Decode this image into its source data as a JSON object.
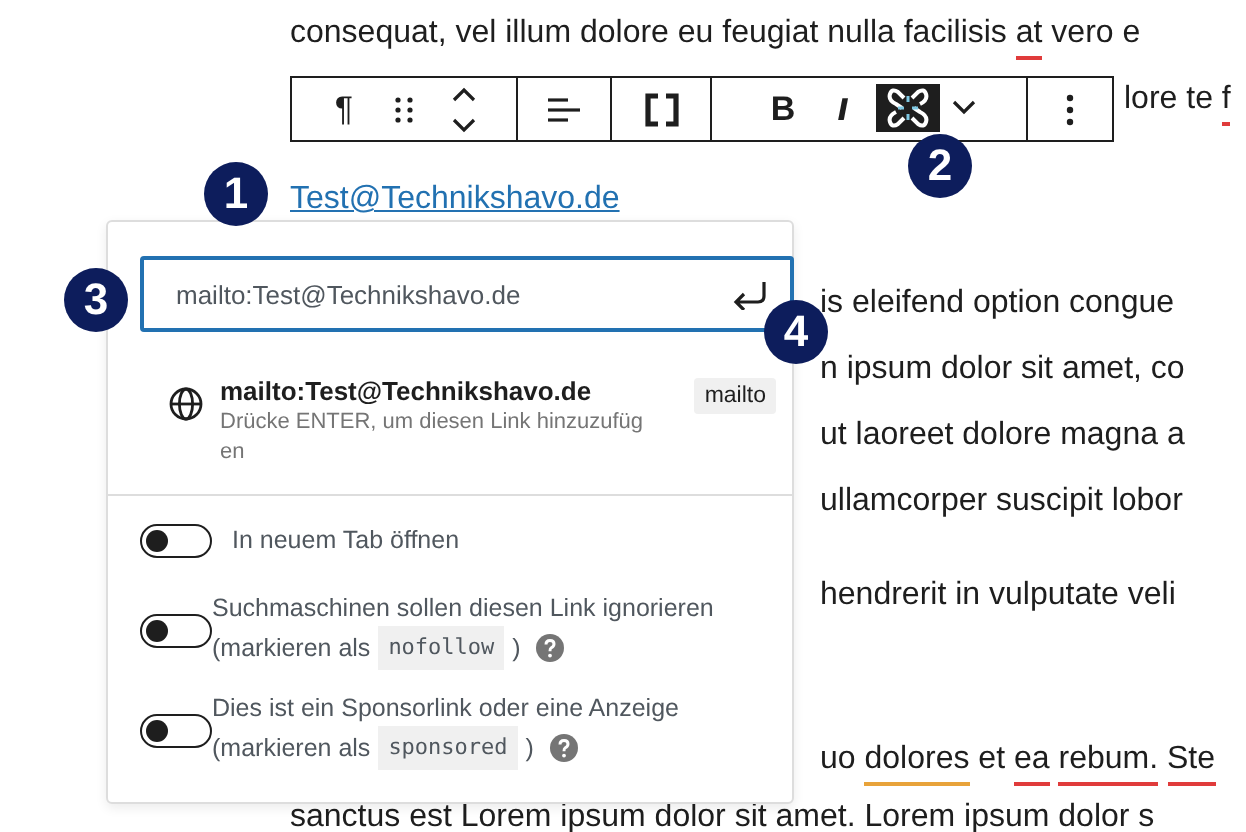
{
  "editor_lines": [
    {
      "kind": "full",
      "parts": [
        {
          "text": "consequat, vel illum dolore eu feugiat nulla facilisis "
        },
        {
          "text": "at",
          "misspelled": true
        },
        {
          "text": " vero e"
        }
      ]
    },
    {
      "kind": "after_toolbar",
      "parts": [
        {
          "text": "lore te "
        },
        {
          "text": "f",
          "misspelled": true
        }
      ]
    },
    {
      "kind": "link",
      "parts": [
        {
          "text": "Test@Technikshavo.de"
        }
      ]
    },
    {
      "kind": "beside_panel",
      "parts": [
        {
          "text": "is eleifend option congue"
        }
      ]
    },
    {
      "kind": "beside_panel",
      "parts": [
        {
          "text": "n ipsum dolor sit amet, co"
        }
      ]
    },
    {
      "kind": "beside_panel",
      "parts": [
        {
          "text": "ut laoreet dolore magna a"
        }
      ]
    },
    {
      "kind": "beside_panel",
      "parts": [
        {
          "text": "ullamcorper suscipit lobor"
        }
      ]
    },
    {
      "kind": "beside_panel",
      "parts": [
        {
          "text": "hendrerit in vulputate veli"
        }
      ]
    },
    {
      "kind": "beside_panel",
      "parts": [
        {
          "text": "uo "
        },
        {
          "text": "dolores",
          "grammar_issue": true
        },
        {
          "text": " et "
        },
        {
          "text": "ea",
          "misspelled": true
        },
        {
          "text": "rebum.",
          "misspelled": true,
          "gap_before": true
        },
        {
          "text": "Ste",
          "misspelled": true,
          "gap_before": true
        }
      ]
    },
    {
      "kind": "full",
      "parts": [
        {
          "text": "sanctus est Lorem ipsum dolor sit amet. Lorem ipsum dolor s"
        }
      ]
    }
  ],
  "toolbar": [
    [
      {
        "kind": "char",
        "text": "¶"
      },
      {
        "kind": "drag"
      },
      {
        "kind": "move"
      }
    ],
    [
      {
        "kind": "align"
      }
    ],
    [
      {
        "kind": "brackets"
      }
    ],
    [
      {
        "kind": "bold",
        "text": "B"
      },
      {
        "kind": "italic",
        "text": "I"
      },
      {
        "kind": "unlink",
        "selected": true
      },
      {
        "kind": "chevron"
      }
    ],
    [
      {
        "kind": "more"
      }
    ]
  ],
  "link_panel": {
    "url_value": "mailto:Test@Technikshavo.de",
    "suggestion": {
      "title": "mailto:Test@Technikshavo.de",
      "hint": "Drücke ENTER, um diesen Link hinzuzufügen",
      "type": "mailto"
    },
    "settings": [
      {
        "label": "In neuem Tab öffnen",
        "on": false
      },
      {
        "label": "Suchmaschinen sollen diesen Link ignorieren",
        "note_prefix": "(markieren als",
        "code": "nofollow",
        "note_suffix": ")",
        "help": true,
        "on": false
      },
      {
        "label": "Dies ist ein Sponsorlink oder eine Anzeige",
        "note_prefix": "(markieren als",
        "code": "sponsored",
        "note_suffix": ")",
        "help": true,
        "on": false
      }
    ]
  },
  "callouts": [
    {
      "text": "1"
    },
    {
      "text": "2"
    },
    {
      "text": "3"
    },
    {
      "text": "4"
    }
  ]
}
